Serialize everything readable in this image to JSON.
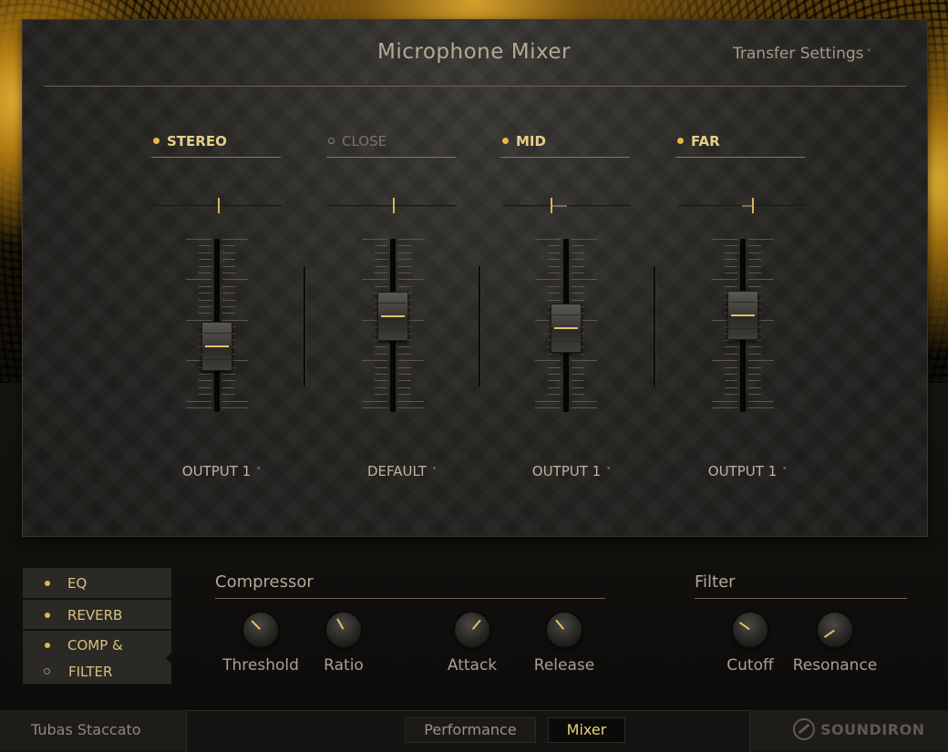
{
  "header": {
    "title": "Microphone Mixer",
    "transfer_label": "Transfer Settings",
    "chevron": "˅"
  },
  "channels": [
    {
      "name": "STEREO",
      "enabled": true,
      "pan": 0.5,
      "level": 0.33,
      "output": "OUTPUT 1"
    },
    {
      "name": "CLOSE",
      "enabled": false,
      "pan": 0.5,
      "level": 0.57,
      "output": "DEFAULT"
    },
    {
      "name": "MID",
      "enabled": true,
      "pan": 0.37,
      "level": 0.48,
      "output": "OUTPUT 1"
    },
    {
      "name": "FAR",
      "enabled": true,
      "pan": 0.58,
      "level": 0.58,
      "output": "OUTPUT 1"
    }
  ],
  "sidebar": {
    "items": [
      {
        "label": "EQ",
        "enabled": true
      },
      {
        "label": "REVERB",
        "enabled": true
      },
      {
        "label_line1": "COMP &",
        "label_line2": "FILTER",
        "line1_enabled": true,
        "line2_enabled": false
      }
    ]
  },
  "compressor": {
    "title": "Compressor",
    "knobs": [
      {
        "label": "Threshold",
        "angle": -45
      },
      {
        "label": "Ratio",
        "angle": -30
      },
      {
        "label": "Attack",
        "angle": 40
      },
      {
        "label": "Release",
        "angle": -40
      }
    ]
  },
  "filter": {
    "title": "Filter",
    "knobs": [
      {
        "label": "Cutoff",
        "angle": -55
      },
      {
        "label": "Resonance",
        "angle": -125
      }
    ]
  },
  "footer": {
    "instrument": "Tubas Staccato",
    "tabs": [
      {
        "label": "Performance",
        "active": false
      },
      {
        "label": "Mixer",
        "active": true
      }
    ],
    "brand": "SOUNDIRON"
  },
  "colors": {
    "accent": "#e6c264",
    "gold_bg": "#b07a12"
  }
}
